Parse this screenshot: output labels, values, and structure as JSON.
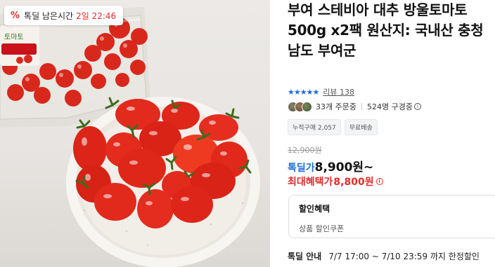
{
  "badge": {
    "icon": "%",
    "label": "톡딜 남은시간",
    "time": "2일 22:46"
  },
  "photo": {
    "package_text": "토마토",
    "package_label_color": "#c9121b",
    "tomato_color": "#e0261b"
  },
  "product": {
    "title": "부여 스테비아 대추 방울토마토 500g x2팩 원산지: 국내산 충청남도 부여군",
    "stars": "★★★★★",
    "review_label": "리뷰 138",
    "order_count": "33개 주문중",
    "subscribers": "524명 구경중",
    "info_glyph": "i"
  },
  "chips": [
    "누적구매 2,057",
    "무료배송"
  ],
  "price": {
    "original": "12,900원",
    "deal_label": "톡딜가",
    "deal_value": "8,900원~",
    "max_label": "최대혜택가",
    "max_value": "8,800원"
  },
  "discount": {
    "heading": "할인혜택",
    "item": "상품 할인쿠폰"
  },
  "deal_guide": {
    "label": "톡딜 안내",
    "text": "7/7 17:00 ~ 7/10 23:59 까지 한정할인"
  },
  "colors": {
    "accent_blue": "#1a6ed8",
    "accent_red": "#e32b2b"
  }
}
